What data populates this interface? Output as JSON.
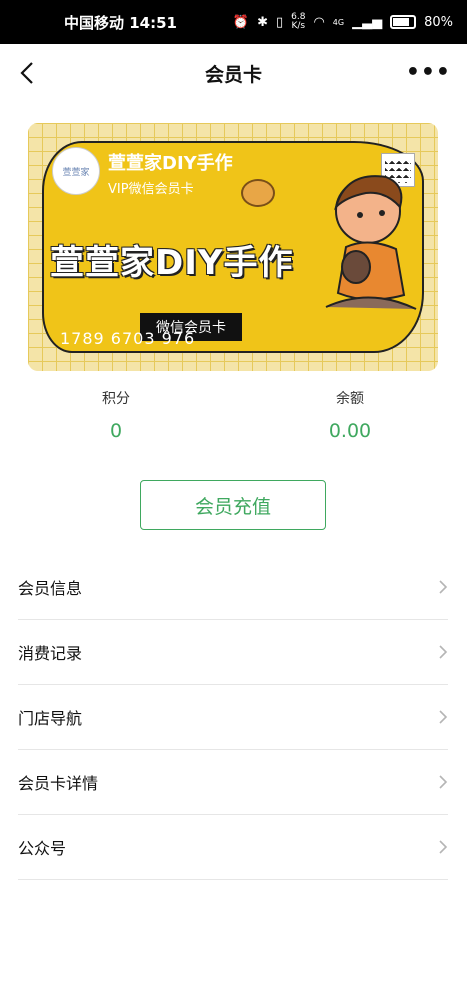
{
  "status_bar": {
    "carrier": "中国移动 14:51",
    "speed_value": "6.8",
    "speed_unit": "K/s",
    "battery": "80%",
    "network": "4G"
  },
  "nav": {
    "title": "会员卡",
    "back_icon": "chevron-left-icon",
    "more_icon": "more-icon"
  },
  "card": {
    "store_name": "萱萱家DIY手作",
    "subtitle": "VIP微信会员卡",
    "big_title": "萱萱家DIY手作",
    "badge": "微信会员卡",
    "number": "1789 6703 976"
  },
  "stats": {
    "points_label": "积分",
    "points_value": "0",
    "balance_label": "余额",
    "balance_value": "0.00"
  },
  "recharge_button": "会员充值",
  "menu": [
    {
      "label": "会员信息"
    },
    {
      "label": "消费记录"
    },
    {
      "label": "门店导航"
    },
    {
      "label": "会员卡详情"
    },
    {
      "label": "公众号"
    }
  ],
  "colors": {
    "accent": "#3fa85f",
    "card_yellow": "#f0c418",
    "status_bar": "#000000"
  }
}
